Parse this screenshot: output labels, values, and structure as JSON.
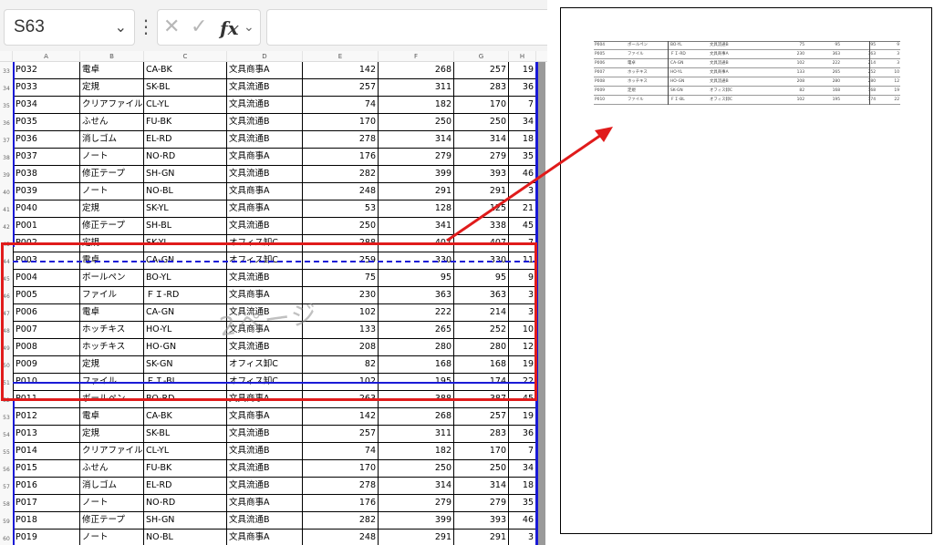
{
  "formula_bar": {
    "name_box": "S63",
    "chevron_icon": "chevron-down-icon",
    "more_icon": "vertical-dots-icon",
    "cancel_icon": "x-icon",
    "confirm_icon": "check-icon",
    "fx_label": "fx",
    "formula_value": ""
  },
  "columns": [
    "A",
    "B",
    "C",
    "D",
    "E",
    "F",
    "G",
    "H"
  ],
  "rows": [
    {
      "n": "33",
      "c": [
        "P032",
        "電卓",
        "CA-BK",
        "文具商事A",
        "142",
        "268",
        "257",
        "19"
      ]
    },
    {
      "n": "34",
      "c": [
        "P033",
        "定規",
        "SK-BL",
        "文具流通B",
        "257",
        "311",
        "283",
        "36"
      ]
    },
    {
      "n": "35",
      "c": [
        "P034",
        "クリアファイル",
        "CL-YL",
        "文具流通B",
        "74",
        "182",
        "170",
        "7"
      ]
    },
    {
      "n": "36",
      "c": [
        "P035",
        "ふせん",
        "FU-BK",
        "文具流通B",
        "170",
        "250",
        "250",
        "34"
      ]
    },
    {
      "n": "37",
      "c": [
        "P036",
        "消しゴム",
        "EL-RD",
        "文具流通B",
        "278",
        "314",
        "314",
        "18"
      ]
    },
    {
      "n": "38",
      "c": [
        "P037",
        "ノート",
        "NO-RD",
        "文具商事A",
        "176",
        "279",
        "279",
        "35"
      ]
    },
    {
      "n": "39",
      "c": [
        "P038",
        "修正テープ",
        "SH-GN",
        "文具流通B",
        "282",
        "399",
        "393",
        "46"
      ]
    },
    {
      "n": "40",
      "c": [
        "P039",
        "ノート",
        "NO-BL",
        "文具商事A",
        "248",
        "291",
        "291",
        "3"
      ]
    },
    {
      "n": "41",
      "c": [
        "P040",
        "定規",
        "SK-YL",
        "文具商事A",
        "53",
        "128",
        "125",
        "21"
      ]
    },
    {
      "n": "42",
      "c": [
        "P001",
        "修正テープ",
        "SH-BL",
        "文具流通B",
        "250",
        "341",
        "338",
        "45"
      ]
    },
    {
      "n": "43",
      "c": [
        "P002",
        "定規",
        "SK-YL",
        "オフィス卸C",
        "288",
        "407",
        "407",
        "7"
      ]
    },
    {
      "n": "44",
      "c": [
        "P003",
        "電卓",
        "CA-GN",
        "オフィス卸C",
        "259",
        "330",
        "330",
        "11"
      ]
    },
    {
      "n": "45",
      "c": [
        "P004",
        "ボールペン",
        "BO-YL",
        "文具流通B",
        "75",
        "95",
        "95",
        "9"
      ]
    },
    {
      "n": "46",
      "c": [
        "P005",
        "ファイル",
        "ＦＩ-RD",
        "文具商事A",
        "230",
        "363",
        "363",
        "3"
      ]
    },
    {
      "n": "47",
      "c": [
        "P006",
        "電卓",
        "CA-GN",
        "文具流通B",
        "102",
        "222",
        "214",
        "3"
      ]
    },
    {
      "n": "48",
      "c": [
        "P007",
        "ホッチキス",
        "HO-YL",
        "文具商事A",
        "133",
        "265",
        "252",
        "10"
      ]
    },
    {
      "n": "49",
      "c": [
        "P008",
        "ホッチキス",
        "HO-GN",
        "文具流通B",
        "208",
        "280",
        "280",
        "12"
      ]
    },
    {
      "n": "50",
      "c": [
        "P009",
        "定規",
        "SK-GN",
        "オフィス卸C",
        "82",
        "168",
        "168",
        "19"
      ]
    },
    {
      "n": "51",
      "c": [
        "P010",
        "ファイル",
        "ＦＩ-BL",
        "オフィス卸C",
        "102",
        "195",
        "174",
        "22"
      ]
    },
    {
      "n": "52",
      "c": [
        "P011",
        "ボールペン",
        "BO-RD",
        "文具商事A",
        "263",
        "388",
        "387",
        "45"
      ]
    },
    {
      "n": "53",
      "c": [
        "P012",
        "電卓",
        "CA-BK",
        "文具商事A",
        "142",
        "268",
        "257",
        "19"
      ]
    },
    {
      "n": "54",
      "c": [
        "P013",
        "定規",
        "SK-BL",
        "文具流通B",
        "257",
        "311",
        "283",
        "36"
      ]
    },
    {
      "n": "55",
      "c": [
        "P014",
        "クリアファイル",
        "CL-YL",
        "文具流通B",
        "74",
        "182",
        "170",
        "7"
      ]
    },
    {
      "n": "56",
      "c": [
        "P015",
        "ふせん",
        "FU-BK",
        "文具流通B",
        "170",
        "250",
        "250",
        "34"
      ]
    },
    {
      "n": "57",
      "c": [
        "P016",
        "消しゴム",
        "EL-RD",
        "文具流通B",
        "278",
        "314",
        "314",
        "18"
      ]
    },
    {
      "n": "58",
      "c": [
        "P017",
        "ノート",
        "NO-RD",
        "文具商事A",
        "176",
        "279",
        "279",
        "35"
      ]
    },
    {
      "n": "59",
      "c": [
        "P018",
        "修正テープ",
        "SH-GN",
        "文具流通B",
        "282",
        "399",
        "393",
        "46"
      ]
    },
    {
      "n": "60",
      "c": [
        "P019",
        "ノート",
        "NO-BL",
        "文具商事A",
        "248",
        "291",
        "291",
        "3"
      ]
    }
  ],
  "page_watermark": "2ページ",
  "preview_rows": [
    [
      "P004",
      "ボールペン",
      "BO-YL",
      "文具流通B",
      "75",
      "95",
      "95",
      "9"
    ],
    [
      "P005",
      "ファイル",
      "ＦＩ-RD",
      "文具商事A",
      "230",
      "363",
      "363",
      "3"
    ],
    [
      "P006",
      "電卓",
      "CA-GN",
      "文具流通B",
      "102",
      "222",
      "214",
      "3"
    ],
    [
      "P007",
      "ホッチキス",
      "HO-YL",
      "文具商事A",
      "133",
      "265",
      "252",
      "10"
    ],
    [
      "P008",
      "ホッチキス",
      "HO-GN",
      "文具流通B",
      "208",
      "280",
      "280",
      "12"
    ],
    [
      "P009",
      "定規",
      "SK-GN",
      "オフィス卸C",
      "82",
      "168",
      "168",
      "19"
    ],
    [
      "P010",
      "ファイル",
      "ＦＩ-BL",
      "オフィス卸C",
      "102",
      "195",
      "174",
      "22"
    ]
  ],
  "colors": {
    "page_break_blue": "#1a1ad6",
    "highlight_red": "#e01b1b",
    "arrow_red": "#e01b1b"
  }
}
